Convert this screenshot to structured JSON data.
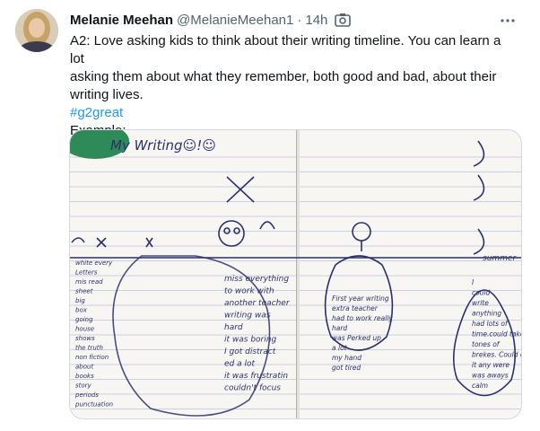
{
  "tweet": {
    "author_name": "Melanie Meehan",
    "author_handle": "@MelanieMeehan1",
    "separator": "·",
    "timestamp": "14h",
    "icons": {
      "media": "camera-icon",
      "more": "more-icon"
    },
    "text_lines": [
      "A2: Love asking kids to think about their writing timeline. You can learn a lot",
      "asking them about what they remember, both good and bad, about their",
      "writing lives."
    ],
    "hashtag": "#g2great",
    "example_label": "Example:"
  },
  "notebook": {
    "title": "My Writing☺!☺",
    "left_notes": [
      "white every",
      "Letters",
      "mis read",
      "sheet",
      "big",
      "box",
      "going",
      "house",
      "shows",
      "the truth",
      "non fiction",
      "about",
      "books",
      "story",
      "periods",
      "punctuation"
    ],
    "middle_notes": [
      "miss everything",
      "to work with",
      "another teacher",
      "writing was",
      "hard",
      "it was boring",
      "I got distract",
      "ed a lot",
      "it was frustratin",
      "couldn't focus"
    ],
    "right_drop_1": [
      "First year writing",
      "extra teacher",
      "had to work really",
      "hard",
      "was Perked up",
      "a lot",
      "my hand",
      "got tired"
    ],
    "right_drop_2": [
      "I",
      "could",
      "write",
      "anything",
      "had lots of",
      "time.could take",
      "tones of",
      "brekes. Could do",
      "it any were",
      "was aways",
      "calm"
    ],
    "summer_label": "summer"
  },
  "colors": {
    "link": "#1d9bf0",
    "muted": "#536471",
    "ink": "#2a2f6e",
    "border": "#cfd9de"
  }
}
